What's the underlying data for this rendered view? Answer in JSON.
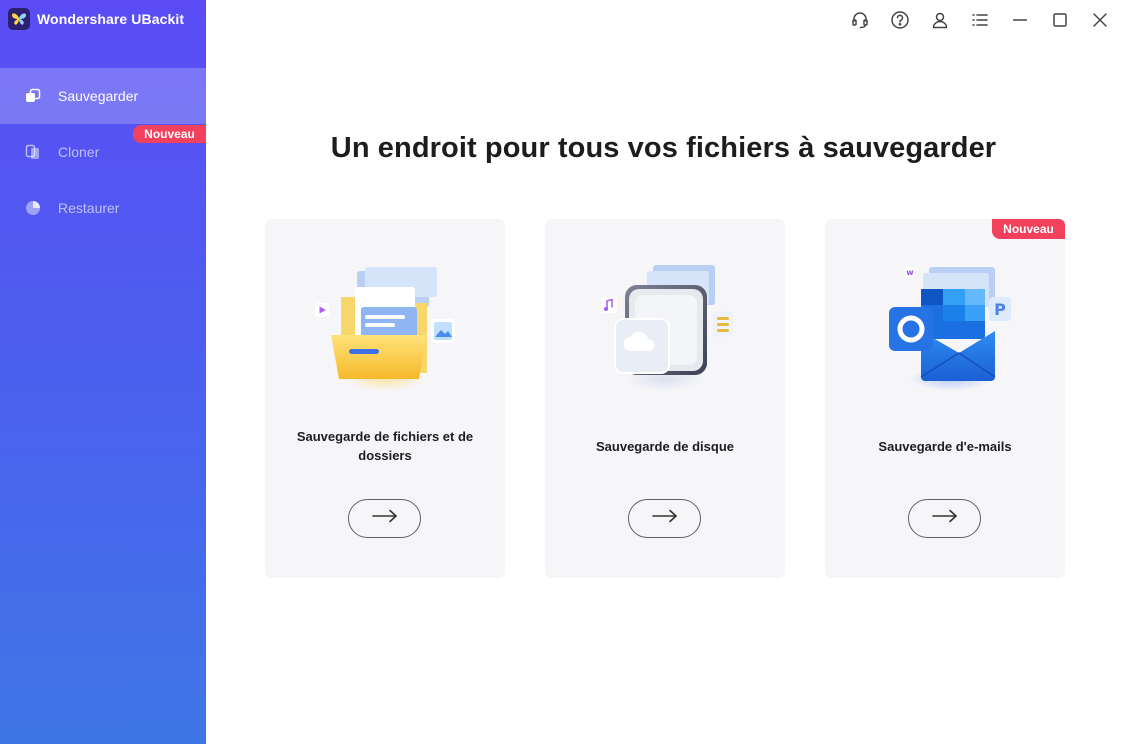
{
  "app": {
    "title": "Wondershare UBackit",
    "logo_icon": "butterfly-logo-icon"
  },
  "sidebar": {
    "items": [
      {
        "label": "Sauvegarder",
        "icon": "backup-icon",
        "active": true
      },
      {
        "label": "Cloner",
        "icon": "clone-icon",
        "active": false
      },
      {
        "label": "Restaurer",
        "icon": "restore-icon",
        "active": false
      }
    ],
    "badge": "Nouveau"
  },
  "topbar": {
    "icons": [
      "headset-support-icon",
      "help-icon",
      "user-account-icon",
      "menu-list-icon",
      "minimize-icon",
      "maximize-icon",
      "close-icon"
    ]
  },
  "main": {
    "headline": "Un endroit pour tous vos fichiers à sauvegarder",
    "cards": [
      {
        "label": "Sauvegarde de fichiers et de dossiers",
        "illustration": "folder-files-illustration",
        "badge": ""
      },
      {
        "label": "Sauvegarde de disque",
        "illustration": "disk-backup-illustration",
        "badge": ""
      },
      {
        "label": "Sauvegarde d'e-mails",
        "illustration": "outlook-email-illustration",
        "badge": "Nouveau"
      }
    ],
    "arrow_icon": "arrow-right-icon"
  },
  "colors": {
    "sidebar_top": "#5b4cf5",
    "sidebar_bottom": "#3f76e6",
    "badge": "#f2415d",
    "card_bg": "#f6f6f8"
  }
}
